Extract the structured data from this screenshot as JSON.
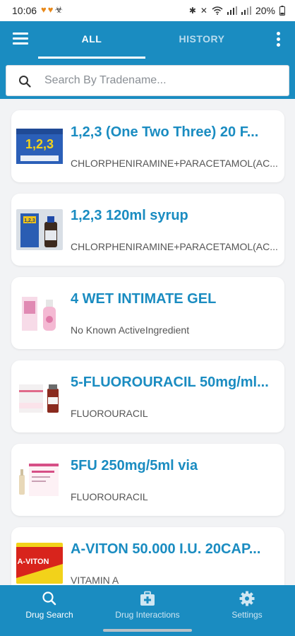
{
  "status_bar": {
    "time": "10:06",
    "battery": "20%"
  },
  "tabs": {
    "all_label": "ALL",
    "history_label": "HISTORY"
  },
  "search": {
    "placeholder": "Search By Tradename..."
  },
  "drugs": [
    {
      "tradename": "1,2,3 (One Two Three) 20 F...",
      "ingredient": "CHLORPHENIRAMINE+PARACETAMOL(AC...",
      "image": "blue-box-thumbnail",
      "thumb_text": "1,2,3"
    },
    {
      "tradename": "1,2,3 120ml syrup",
      "ingredient": "CHLORPHENIRAMINE+PARACETAMOL(AC...",
      "image": "syrup-bottle-thumbnail",
      "thumb_text": "1,2,3"
    },
    {
      "tradename": "4 WET INTIMATE GEL",
      "ingredient": "No Known ActiveIngredient",
      "image": "pink-gel-thumbnail"
    },
    {
      "tradename": "5-FLUOROURACIL 50mg/ml...",
      "ingredient": "FLUOROURACIL",
      "image": "vial-box-thumbnail"
    },
    {
      "tradename": "5FU 250mg/5ml via",
      "ingredient": "FLUOROURACIL",
      "image": "ampoule-box-thumbnail"
    },
    {
      "tradename": "A-VITON 50.000 I.U. 20CAP...",
      "ingredient": "VITAMIN A",
      "image": "red-box-thumbnail",
      "thumb_text": "A-VITON"
    }
  ],
  "bottom_nav": {
    "drug_search": "Drug Search",
    "drug_interactions": "Drug Interactions",
    "settings": "Settings"
  },
  "colors": {
    "primary": "#1a8cc1",
    "title_text": "#1a8cc1",
    "background": "#f2f3f5"
  }
}
